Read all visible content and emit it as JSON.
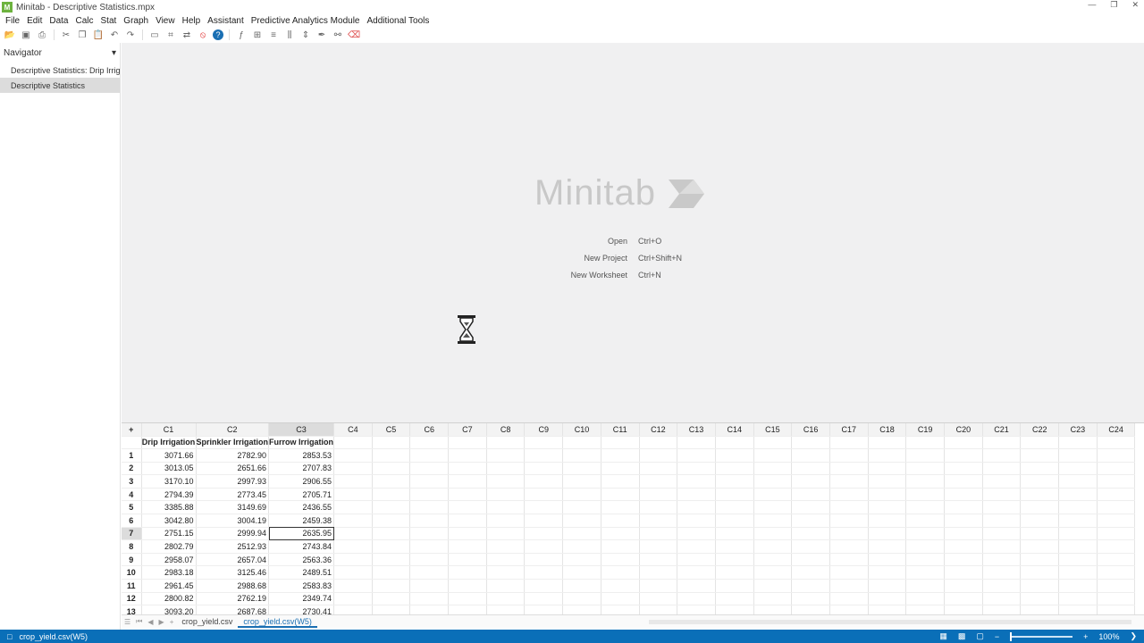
{
  "window": {
    "title": "Minitab - Descriptive Statistics.mpx",
    "app_icon": "minitab-icon"
  },
  "menu": [
    "File",
    "Edit",
    "Data",
    "Calc",
    "Stat",
    "Graph",
    "View",
    "Help",
    "Assistant",
    "Predictive Analytics Module",
    "Additional Tools"
  ],
  "toolbar": [
    "open-icon",
    "save-icon",
    "print-icon",
    "cut-icon",
    "copy-icon",
    "paste-icon",
    "undo-icon",
    "redo-icon",
    "window-icon",
    "find-icon",
    "replace-icon",
    "cancel-icon",
    "help-icon",
    "fx-icon",
    "insert-cells-icon",
    "insert-rows-icon",
    "insert-columns-icon",
    "move-columns-icon",
    "brush-icon",
    "link-icon",
    "clear-icon"
  ],
  "navigator": {
    "title": "Navigator",
    "items": [
      {
        "label": "Descriptive Statistics: Drip Irrig...",
        "selected": false
      },
      {
        "label": "Descriptive Statistics",
        "selected": true
      }
    ]
  },
  "start": {
    "logo_text": "Minitab",
    "quick_links": [
      {
        "label": "Open",
        "shortcut": "Ctrl+O"
      },
      {
        "label": "New Project",
        "shortcut": "Ctrl+Shift+N"
      },
      {
        "label": "New Worksheet",
        "shortcut": "Ctrl+N"
      }
    ]
  },
  "worksheet": {
    "corner": "+",
    "columns": [
      "C1",
      "C2",
      "C3",
      "C4",
      "C5",
      "C6",
      "C7",
      "C8",
      "C9",
      "C10",
      "C11",
      "C12",
      "C13",
      "C14",
      "C15",
      "C16",
      "C17",
      "C18",
      "C19",
      "C20",
      "C21",
      "C22",
      "C23",
      "C24"
    ],
    "column_names": [
      "Drip Irrigation",
      "Sprinkler Irrigation",
      "Furrow Irrigation"
    ],
    "active_column": 2,
    "active_row": 6,
    "rows": [
      [
        "1",
        "3071.66",
        "2782.90",
        "2853.53"
      ],
      [
        "2",
        "3013.05",
        "2651.66",
        "2707.83"
      ],
      [
        "3",
        "3170.10",
        "2997.93",
        "2906.55"
      ],
      [
        "4",
        "2794.39",
        "2773.45",
        "2705.71"
      ],
      [
        "5",
        "3385.88",
        "3149.69",
        "2436.55"
      ],
      [
        "6",
        "3042.80",
        "3004.19",
        "2459.38"
      ],
      [
        "7",
        "2751.15",
        "2999.94",
        "2635.95"
      ],
      [
        "8",
        "2802.79",
        "2512.93",
        "2743.84"
      ],
      [
        "9",
        "2958.07",
        "2657.04",
        "2563.36"
      ],
      [
        "10",
        "2983.18",
        "3125.46",
        "2489.51"
      ],
      [
        "11",
        "2961.45",
        "2988.68",
        "2583.83"
      ],
      [
        "12",
        "2800.82",
        "2762.19",
        "2349.74"
      ],
      [
        "13",
        "3093.20",
        "2687.68",
        "2730.41"
      ]
    ]
  },
  "sheet_tabs": [
    {
      "label": "crop_yield.csv",
      "active": false
    },
    {
      "label": "crop_yield.csv(W5)",
      "active": true
    }
  ],
  "status": {
    "left_text": "crop_yield.csv(W5)",
    "zoom": "100%"
  },
  "colors": {
    "status_bar": "#0a6fb8",
    "accent": "#1a6fb3"
  }
}
